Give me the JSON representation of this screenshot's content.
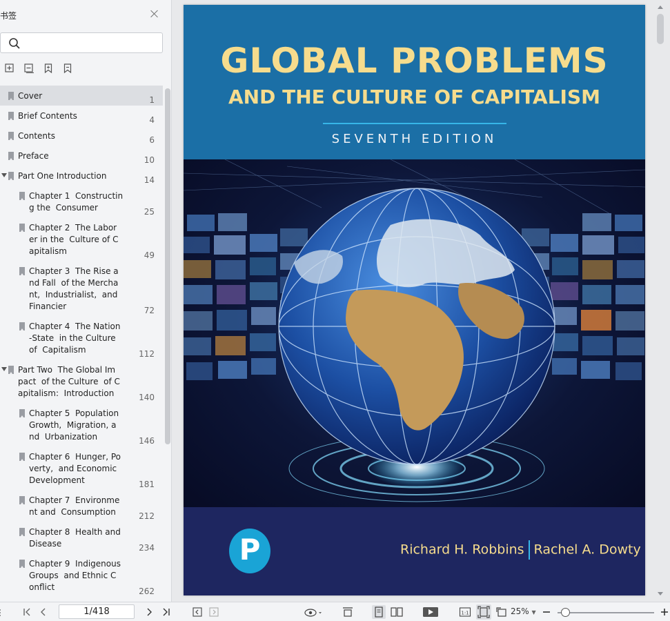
{
  "sidebar": {
    "title": "书签",
    "search_placeholder": "",
    "tools": [
      "expand-all-icon",
      "collapse-all-icon",
      "add-bookmark-icon",
      "bookmark-icon"
    ],
    "bookmarks": [
      {
        "label": "Cover",
        "page": "1",
        "level": 1,
        "selected": true
      },
      {
        "label": "Brief Contents",
        "page": "4",
        "level": 1
      },
      {
        "label": "Contents",
        "page": "6",
        "level": 1
      },
      {
        "label": "Preface",
        "page": "10",
        "level": 1
      },
      {
        "label": "Part One Introduction",
        "page": "14",
        "level": 1,
        "expanded": true
      },
      {
        "label": "Chapter 1  Constructin\ng the  Consumer",
        "page": "25",
        "level": 2
      },
      {
        "label": "Chapter 2  The Labor\ner in the  Culture of C\napitalism",
        "page": "49",
        "level": 2
      },
      {
        "label": "Chapter 3  The Rise a\nnd Fall  of the Mercha\nnt,  Industrialist,  and\nFinancier",
        "page": "72",
        "level": 2
      },
      {
        "label": "Chapter 4  The Nation\n-State  in the Culture\nof  Capitalism",
        "page": "112",
        "level": 2
      },
      {
        "label": "Part Two  The Global Im\npact  of the Culture  of C\napitalism:  Introduction",
        "page": "140",
        "level": 1,
        "expanded": true
      },
      {
        "label": "Chapter 5  Population\nGrowth,  Migration, a\nnd  Urbanization",
        "page": "146",
        "level": 2
      },
      {
        "label": "Chapter 6  Hunger, Po\nverty,  and Economic\nDevelopment",
        "page": "181",
        "level": 2
      },
      {
        "label": "Chapter 7  Environme\nnt and  Consumption",
        "page": "212",
        "level": 2
      },
      {
        "label": "Chapter 8  Health and\nDisease",
        "page": "234",
        "level": 2
      },
      {
        "label": "Chapter 9  Indigenous\nGroups  and Ethnic C\nonflict",
        "page": "262",
        "level": 2
      }
    ]
  },
  "cover": {
    "title_line1": "GLOBAL PROBLEMS",
    "title_line2": "AND THE CULTURE OF CAPITALISM",
    "edition": "SEVENTH EDITION",
    "author1": "Richard H. Robbins",
    "author2": "Rachel A. Dowty",
    "logo_letter": "P",
    "colors": {
      "top_band": "#1b6fa6",
      "title": "#f6dc8d",
      "bottom_band": "#1e2660",
      "logo": "#1aa4d6"
    }
  },
  "statusbar": {
    "page_indicator": "1/418",
    "zoom": "25%",
    "zoom_level": 0.08,
    "icons": [
      "first-page-icon",
      "prev-page-icon",
      "next-page-icon",
      "last-page-icon",
      "back-icon",
      "forward-icon",
      "view-mode-icon",
      "fit-width-icon",
      "single-page-icon",
      "two-page-icon",
      "play-icon",
      "actual-size-icon",
      "fit-page-icon",
      "rotate-icon",
      "zoom-out-icon",
      "zoom-in-icon"
    ],
    "actual_size_label": "1:1"
  }
}
